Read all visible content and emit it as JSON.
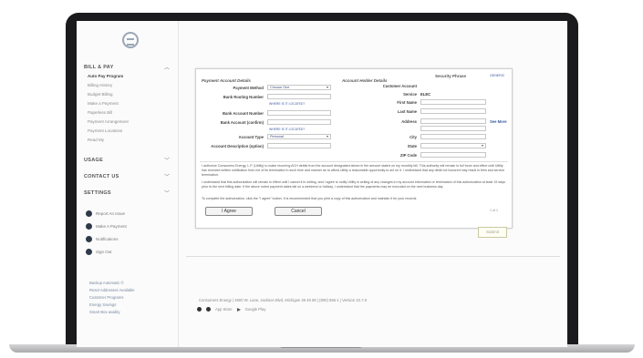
{
  "sidebar": {
    "bill_pay_title": "BILL & PAY",
    "bill_pay_items": [
      "Auto Pay Program",
      "Billing History",
      "Budget Billing",
      "Make a Payment",
      "Paperless Bill",
      "Payment Arrangement",
      "Payment Locations",
      "Read My"
    ],
    "usage_title": "USAGE",
    "contact_title": "CONTACT US",
    "settings_title": "SETTINGS",
    "actions": [
      {
        "label": "Report An Issue",
        "icon": "alert-icon"
      },
      {
        "label": "Make A Payment",
        "icon": "dollar-icon"
      },
      {
        "label": "Notifications",
        "icon": "bell-icon"
      },
      {
        "label": "Sign Out",
        "icon": "sign-out-icon"
      }
    ],
    "footer_links": [
      "Backup Automatic ©",
      "Reset Addresses Available",
      "Customer Programs",
      "Energy Savings",
      "Smart Box availity"
    ]
  },
  "form": {
    "left_title": "Payment Account Details",
    "right_title": "Account Holder Details",
    "security_phrase": "Security Phrase",
    "security_phrase_value": "GENERIC",
    "payment_method_label": "Payment Method",
    "payment_method_value": "Choose One",
    "routing_label": "Bank Routing Number",
    "routing_value": "WHERE IS IT LOCATED?",
    "account_number_label": "Bank Account Number",
    "verify_label": "Bank Account (confirm)",
    "verify_value": "WHERE IS IT LOCATED?",
    "account_type_label": "Account Type",
    "account_type_value": "Personal",
    "description_label": "Account Description (option)",
    "customer_account_label": "Customer Account",
    "service_label": "Service",
    "service_value": "ELEC",
    "first_name_label": "First Name",
    "last_name_label": "Last Name",
    "address_label": "Address",
    "see_more": "See More",
    "city_label": "City",
    "state_label": "State",
    "zip_label": "ZIP Code",
    "authorization_text_1": "I authorize Consumers Energy, L.P. (Utility) to make recurring ACH debits from the account designated above in the amount stated on my monthly bill. This authority will remain in full force and effect until Utility has received written notification from me of its termination in such time and manner as to afford Utility a reasonable opportunity to act on it. I understand that any debit not honored may result in fees and service termination.",
    "authorization_text_2": "I understand that this authorization will remain in effect until I cancel it in writing, and I agree to notify Utility in writing of any changes in my account information or termination of this authorization at least 15 days prior to the next billing date. If the above noted payment dates fall on a weekend or holiday, I understand that the payments may be executed on the next business day.",
    "consent_text": "To complete the authorization, click the \"I agree\" button. It is recommended that you print a copy of this authorization and maintain it for your records.",
    "agree_button": "I Agree",
    "cancel_button": "Cancel",
    "pager": "1 of 1"
  },
  "submit_button": "Submit",
  "page_footer": {
    "text": "Consumers Energy  |  4600 W. Lane, Jackson Blvd, Michigan 49 49 98  |  (800) 555-1   |  Version 10.7.8",
    "app_store": "App Store",
    "google_play": "Google Play"
  },
  "colors": {
    "accent": "#3a5aa0",
    "frame": "#1b1b1d",
    "dark_icon": "#2e3a4a"
  }
}
